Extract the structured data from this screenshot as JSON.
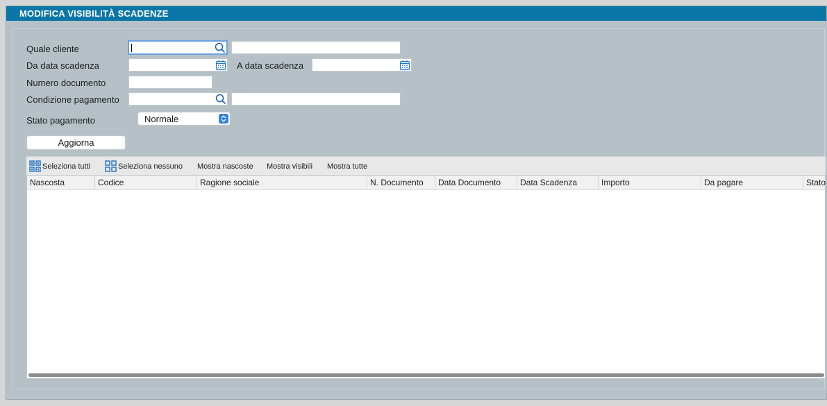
{
  "window": {
    "title": "MODIFICA VISIBILITÀ SCADENZE"
  },
  "form": {
    "cliente_label": "Quale cliente",
    "cliente_code_value": "",
    "cliente_name_value": "",
    "da_data_label": "Da data scadenza",
    "da_data_value": "",
    "a_data_label": "A data scadenza",
    "a_data_value": "",
    "numero_doc_label": "Numero documento",
    "numero_doc_value": "",
    "condizione_label": "Condizione pagamento",
    "condizione_code_value": "",
    "condizione_desc_value": "",
    "stato_label": "Stato pagamento",
    "stato_value": "Normale",
    "refresh_label": "Aggiorna"
  },
  "toolbar": {
    "select_all": "Seleziona tutti",
    "select_none": "Seleziona nessuno",
    "show_hidden": "Mostra nascoste",
    "show_visible": "Mostra visibili",
    "show_all": "Mostra tutte"
  },
  "grid": {
    "columns": [
      "Nascosta",
      "Codice",
      "Ragione sociale",
      "N. Documento",
      "Data Documento",
      "Data Scadenza",
      "Importo",
      "Da pagare",
      "Stato"
    ],
    "rows": []
  },
  "colors": {
    "titlebar": "#0a76a8",
    "panel": "#b5c1c7",
    "accent": "#2f80e6"
  },
  "icons": [
    "search-icon",
    "calendar-icon",
    "select-chevron-icon",
    "grid-select-icon"
  ]
}
